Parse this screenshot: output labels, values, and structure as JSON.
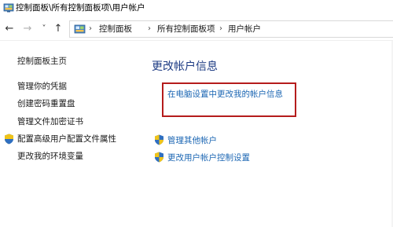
{
  "window": {
    "title": "控制面板\\所有控制面板项\\用户帐户"
  },
  "nav": {
    "back_icon": "←",
    "forward_icon": "→",
    "recent_icon": "˅",
    "up_icon": "↑"
  },
  "address": {
    "separator": "›",
    "crumbs": [
      "控制面板",
      "所有控制面板项",
      "用户帐户"
    ]
  },
  "sidebar": {
    "items": [
      {
        "label": "控制面板主页",
        "icon": ""
      },
      {
        "label": "管理你的凭据",
        "icon": ""
      },
      {
        "label": "创建密码重置盘",
        "icon": ""
      },
      {
        "label": "管理文件加密证书",
        "icon": ""
      },
      {
        "label": "配置高级用户配置文件属性",
        "icon": "shield-icon"
      },
      {
        "label": "更改我的环境变量",
        "icon": ""
      }
    ]
  },
  "main": {
    "heading": "更改帐户信息",
    "highlighted_link": "在电脑设置中更改我的帐户信息",
    "links": [
      {
        "label": "管理其他帐户",
        "icon": "shield-icon"
      },
      {
        "label": "更改用户帐户控制设置",
        "icon": "shield-icon"
      }
    ]
  },
  "colors": {
    "heading": "#1e3c84",
    "link": "#1b66b3",
    "highlight_border": "#b51c1c"
  }
}
